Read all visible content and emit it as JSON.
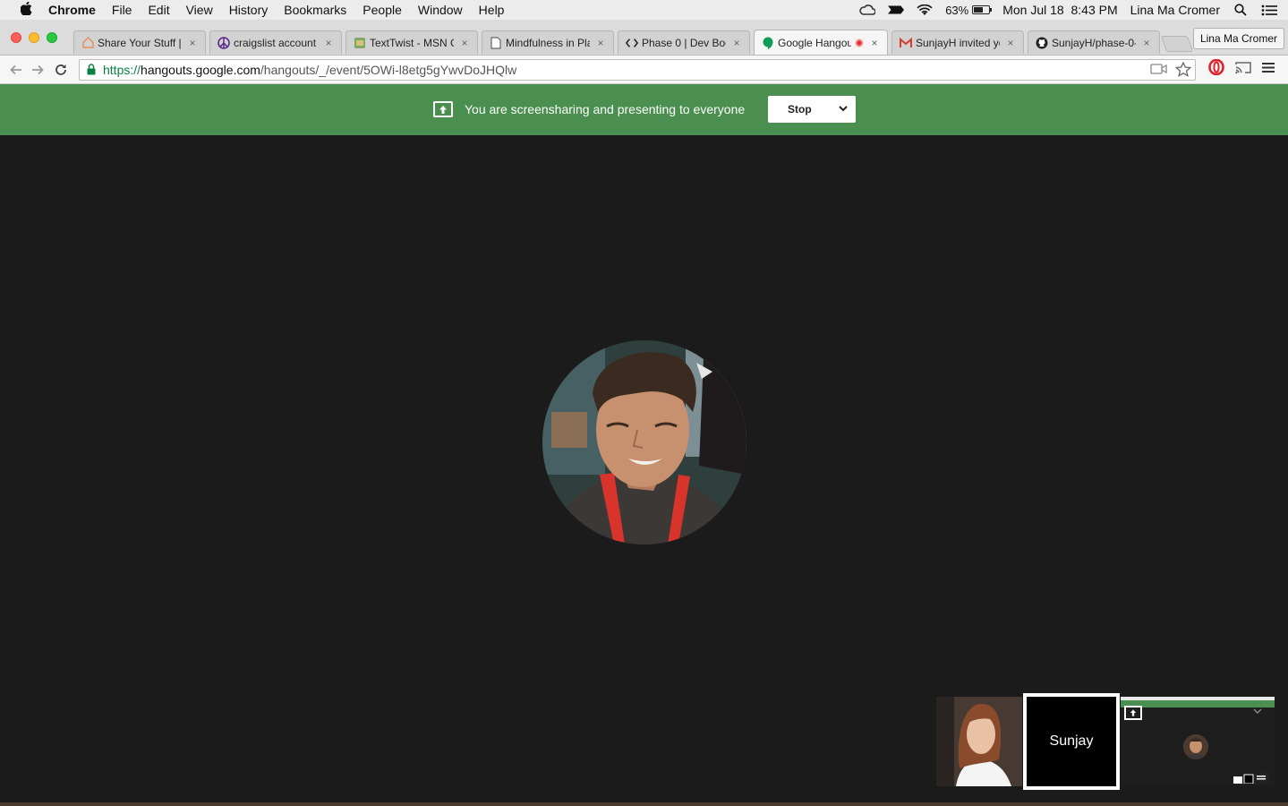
{
  "menubar": {
    "apple_icon": "apple-icon",
    "app_name": "Chrome",
    "items": [
      "File",
      "Edit",
      "View",
      "History",
      "Bookmarks",
      "People",
      "Window",
      "Help"
    ],
    "battery_percent": "63%",
    "battery_level": 0.63,
    "datetime": "Mon Jul 18  8:43 PM",
    "user": "Lina Ma Cromer"
  },
  "tabs": [
    {
      "label": "Share Your Stuff | ",
      "icon": "house-icon",
      "active": false
    },
    {
      "label": "craigslist account",
      "icon": "peace-icon",
      "active": false
    },
    {
      "label": "TextTwist - MSN G",
      "icon": "game-icon",
      "active": false
    },
    {
      "label": "Mindfulness in Pla",
      "icon": "document-icon",
      "active": false
    },
    {
      "label": "Phase 0 | Dev Boo",
      "icon": "code-icon",
      "active": false
    },
    {
      "label": "Google Hangou",
      "icon": "hangouts-icon",
      "active": true
    },
    {
      "label": "SunjayH invited yo",
      "icon": "gmail-icon",
      "active": false
    },
    {
      "label": "SunjayH/phase-0-",
      "icon": "github-icon",
      "active": false
    }
  ],
  "profile_button": "Lina Ma Cromer",
  "address": {
    "scheme": "https://",
    "host": "hangouts.google.com",
    "path": "/hangouts/_/event/5OWi-l8etg5gYwvDoJHQlw"
  },
  "banner": {
    "text": "You are screensharing and presenting to everyone",
    "stop_label": "Stop"
  },
  "participants": {
    "tile_name": "Sunjay"
  },
  "colors": {
    "banner_green": "#4a8f4f",
    "stage_bg": "#1b1b1b",
    "lanyard_red": "#d9342b"
  }
}
